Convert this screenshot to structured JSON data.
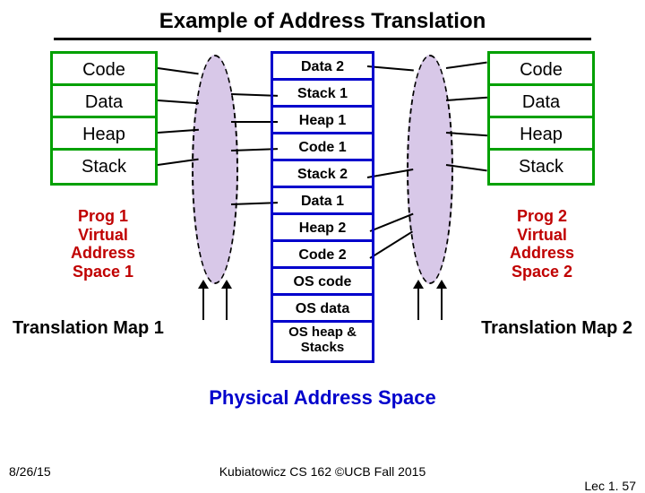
{
  "title": "Example of Address Translation",
  "vas_left": {
    "cells": [
      "Code",
      "Data",
      "Heap",
      "Stack"
    ],
    "label_lines": [
      "Prog 1",
      "Virtual",
      "Address",
      "Space 1"
    ]
  },
  "vas_right": {
    "cells": [
      "Code",
      "Data",
      "Heap",
      "Stack"
    ],
    "label_lines": [
      "Prog 2",
      "Virtual",
      "Address",
      "Space 2"
    ]
  },
  "phys": {
    "cells": [
      "Data 2",
      "Stack 1",
      "Heap 1",
      "Code 1",
      "Stack 2",
      "Data 1",
      "Heap 2",
      "Code 2",
      "OS code",
      "OS data"
    ],
    "last": "OS heap &\nStacks",
    "label": "Physical Address Space"
  },
  "tmap_left": "Translation Map 1",
  "tmap_right": "Translation Map 2",
  "footer": {
    "date": "8/26/15",
    "center": "Kubiatowicz CS 162 ©UCB Fall 2015",
    "lec": "Lec 1. 57"
  }
}
